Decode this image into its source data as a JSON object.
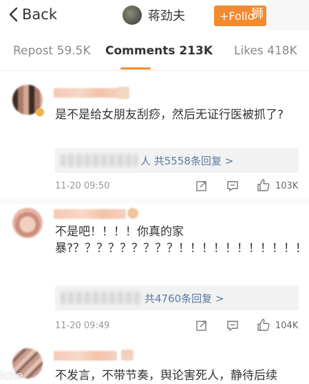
{
  "header": {
    "back_label": "Back",
    "title": "蒋劲夫",
    "follow_label": "+Follo",
    "watermark": "狮"
  },
  "tabs": [
    {
      "label": "Repost 59.5K"
    },
    {
      "label": "Comments 213K"
    },
    {
      "label": "Likes 418K"
    }
  ],
  "comments": [
    {
      "text": "是不是给女朋友刮痧，然后无证行医被抓了?",
      "reply_summary": "人  共5558条回复 >",
      "time": "11-20 09:50",
      "likes": "103K"
    },
    {
      "text": "不是吧！！！！你真的家暴?？？？？？？？？？！！！！！！！！！！！！",
      "reply_summary": "共4760条回复 >",
      "time": "11-20 09:49",
      "likes": "104K"
    },
    {
      "text": "不发言，不带节奏，舆论害死人，静待后续"
    }
  ],
  "bottom_watermark": "iche",
  "colors": {
    "accent": "#f28a2f",
    "link": "#5b7aa3"
  }
}
